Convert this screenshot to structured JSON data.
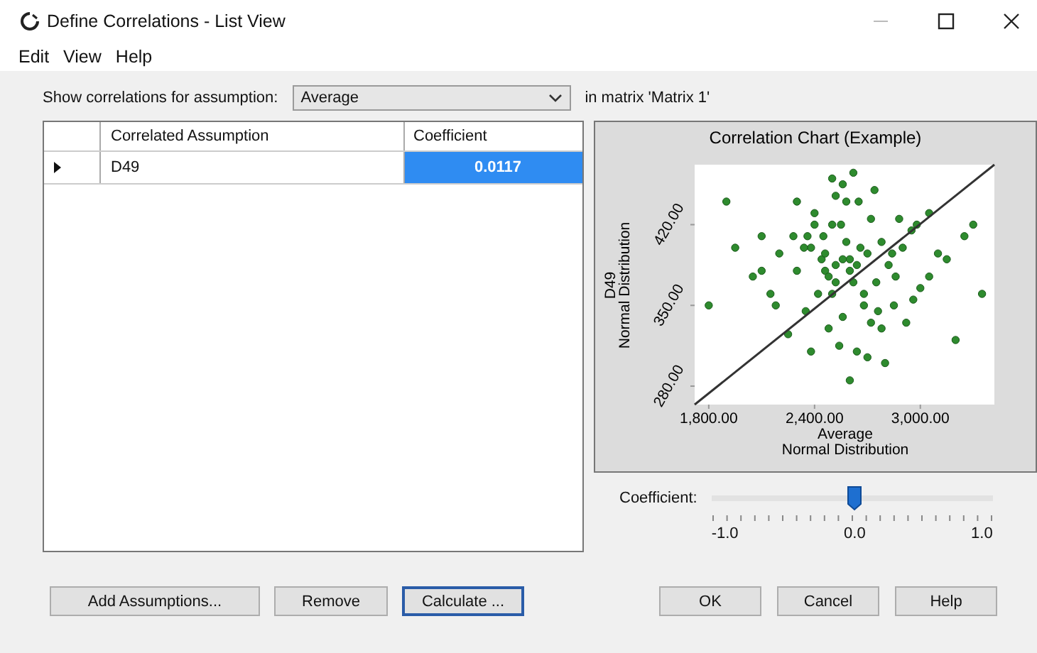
{
  "window": {
    "title": "Define Correlations - List View"
  },
  "menu": [
    {
      "label": "Edit"
    },
    {
      "label": "View"
    },
    {
      "label": "Help"
    }
  ],
  "assumption": {
    "label": "Show correlations for assumption:",
    "value": "Average",
    "matrix_text": "in matrix 'Matrix 1'"
  },
  "table": {
    "columns": [
      "Correlated Assumption",
      "Coefficient"
    ],
    "rows": [
      {
        "current": true,
        "assumption": "D49",
        "coefficient": "0.0117",
        "coefficient_selected": true
      }
    ]
  },
  "chart": {
    "chart_data": {
      "type": "scatter",
      "title": "Correlation Chart (Example)",
      "xlabel": [
        "Average",
        "Normal Distribution"
      ],
      "ylabel": [
        "D49",
        "Normal Distribution"
      ],
      "xlim": [
        1720,
        3420
      ],
      "ylim": [
        264,
        472
      ],
      "xticks": [
        {
          "value": 1800,
          "label": "1,800.00"
        },
        {
          "value": 2400,
          "label": "2,400.00"
        },
        {
          "value": 3000,
          "label": "3,000.00"
        }
      ],
      "yticks": [
        {
          "value": 280,
          "label": "280.00"
        },
        {
          "value": 350,
          "label": "350.00"
        },
        {
          "value": 420,
          "label": "420.00"
        }
      ],
      "x": [
        2600,
        2450,
        2750,
        2300,
        2900,
        2550,
        2680,
        2400,
        2820,
        2500,
        2200,
        3050,
        2650,
        2350,
        2950,
        2580,
        2480,
        2720,
        2150,
        3150,
        2620,
        2380,
        2850,
        2520,
        2700,
        2280,
        3000,
        2460,
        2780,
        2560,
        2050,
        3250,
        2640,
        2420,
        2880,
        2540,
        2340,
        2760,
        2600,
        2500,
        1900,
        3350,
        2700,
        2440,
        2920,
        2180,
        2660,
        2580,
        2800,
        2360,
        1800,
        3100,
        2520,
        2620,
        2980,
        2250,
        2740,
        2480,
        2840,
        2560,
        2100,
        3200,
        2680,
        2400,
        2560,
        2300,
        2860,
        2640,
        2960,
        2460,
        1950,
        3300,
        2720,
        2520,
        2380,
        2780,
        2600,
        2100,
        3050,
        2500
      ],
      "series": [
        {
          "color": "#2e8b2e",
          "values": [
            390,
            410,
            370,
            380,
            400,
            420,
            350,
            430,
            385,
            360,
            395,
            375,
            440,
            345,
            415,
            405,
            330,
            425,
            360,
            390,
            370,
            400,
            350,
            445,
            395,
            410,
            365,
            380,
            330,
            455,
            375,
            410,
            385,
            360,
            425,
            315,
            400,
            345,
            380,
            420,
            440,
            360,
            305,
            390,
            335,
            350,
            400,
            440,
            300,
            410,
            350,
            395,
            385,
            465,
            420,
            325,
            450,
            375,
            395,
            340,
            410,
            320,
            360,
            420,
            390,
            440,
            375,
            310,
            355,
            395,
            400,
            420,
            335,
            370,
            310,
            405,
            285,
            380,
            430,
            460
          ]
        },
        {
          "type": "line",
          "color": "#333333",
          "x": [
            1720,
            3420
          ],
          "values": [
            264,
            472
          ]
        }
      ]
    }
  },
  "slider": {
    "label": "Coefficient:",
    "level": 0.506,
    "tick_labels": [
      "-1.0",
      "0.0",
      "1.0"
    ]
  },
  "left_buttons": [
    {
      "label": "Add Assumptions...",
      "focused": false
    },
    {
      "label": "Remove",
      "focused": false
    },
    {
      "label": "Calculate ...",
      "focused": true
    }
  ],
  "right_buttons": [
    {
      "label": "OK"
    },
    {
      "label": "Cancel"
    },
    {
      "label": "Help"
    }
  ]
}
